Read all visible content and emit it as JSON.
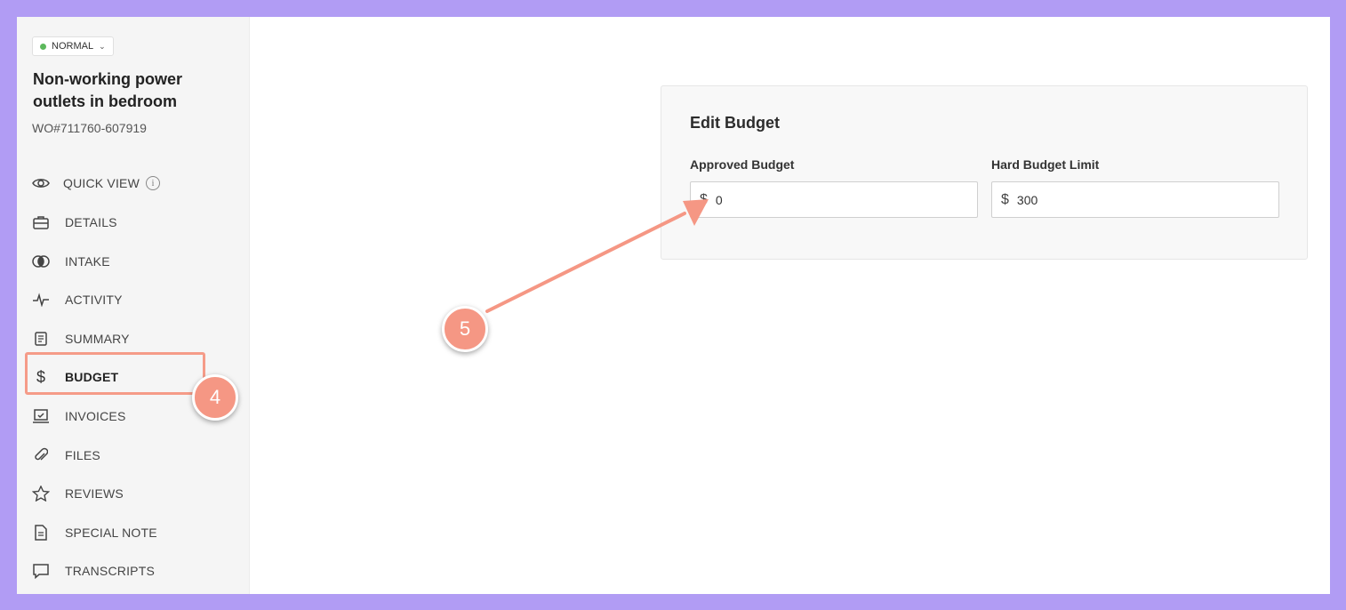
{
  "sidebar": {
    "priority_label": "NORMAL",
    "title": "Non-working power outlets in bedroom",
    "work_order_id": "WO#711760-607919",
    "nav_items": [
      {
        "label": "QUICK VIEW",
        "icon": "eye-icon"
      },
      {
        "label": "DETAILS",
        "icon": "briefcase-icon"
      },
      {
        "label": "INTAKE",
        "icon": "intake-icon"
      },
      {
        "label": "ACTIVITY",
        "icon": "activity-pulse-icon"
      },
      {
        "label": "SUMMARY",
        "icon": "summary-doc-icon"
      },
      {
        "label": "BUDGET",
        "icon": "dollar-icon",
        "active": true
      },
      {
        "label": "INVOICES",
        "icon": "invoice-icon"
      },
      {
        "label": "FILES",
        "icon": "paperclip-icon"
      },
      {
        "label": "REVIEWS",
        "icon": "star-icon"
      },
      {
        "label": "SPECIAL NOTE",
        "icon": "note-icon"
      },
      {
        "label": "TRANSCRIPTS",
        "icon": "chat-bubble-icon"
      }
    ]
  },
  "budget_panel": {
    "title": "Edit Budget",
    "approved_label": "Approved Budget",
    "approved_currency": "$",
    "approved_value": "0",
    "hard_limit_label": "Hard Budget Limit",
    "hard_limit_currency": "$",
    "hard_limit_value": "300"
  },
  "annotations": {
    "step4": "4",
    "step5": "5",
    "accent_color": "#f59784"
  },
  "colors": {
    "background": "#b19cf4",
    "status_dot": "#5cb85c"
  }
}
